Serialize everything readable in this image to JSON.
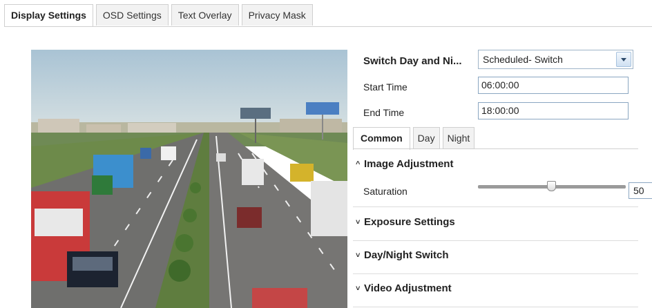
{
  "tabs": [
    "Display Settings",
    "OSD Settings",
    "Text Overlay",
    "Privacy Mask"
  ],
  "form": {
    "switch_label": "Switch Day and Ni...",
    "switch_value": "Scheduled- Switch",
    "start_label": "Start Time",
    "start_value": "06:00:00",
    "end_label": "End Time",
    "end_value": "18:00:00"
  },
  "subtabs": [
    "Common",
    "Day",
    "Night"
  ],
  "sections": {
    "image_adjustment": "Image Adjustment",
    "exposure": "Exposure Settings",
    "day_night": "Day/Night Switch",
    "video_adjustment": "Video Adjustment"
  },
  "saturation": {
    "label": "Saturation",
    "value": "50"
  },
  "icons": {
    "expanded": "caret-up-icon",
    "collapsed": "caret-down-icon",
    "select": "dropdown-arrow-icon"
  }
}
